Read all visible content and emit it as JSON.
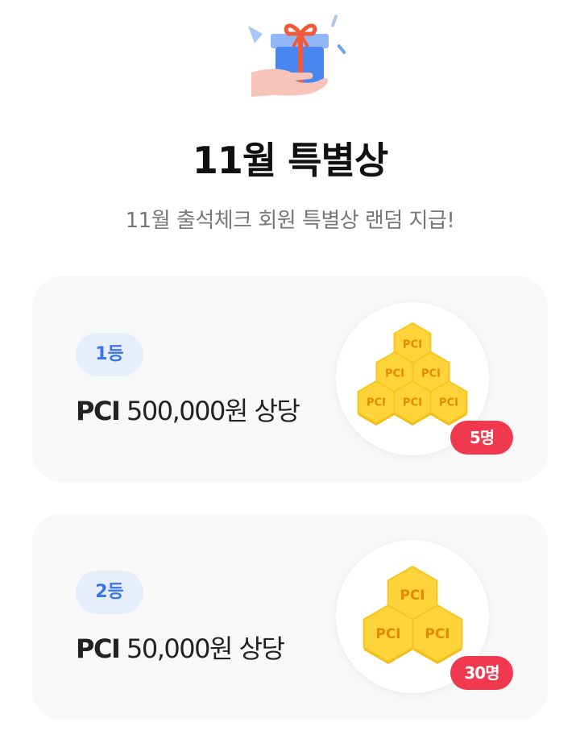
{
  "header": {
    "title": "11월 특별상",
    "subtitle": "11월 출석체크 회원 특별상 랜덤 지급!"
  },
  "icons": {
    "hero": "gift-in-hand-icon",
    "coin": "pci-coin-icon"
  },
  "colors": {
    "rank_badge_bg": "#e6eefc",
    "rank_badge_text": "#3b74e8",
    "count_badge": "#f0384f",
    "coin_gold": "#ffd43b",
    "coin_text": "#e58a00"
  },
  "prizes": [
    {
      "rank": "1등",
      "brand": "PCI",
      "amount": "500,000원 상당",
      "count": "5명",
      "coin_label": "PCI"
    },
    {
      "rank": "2등",
      "brand": "PCI",
      "amount": "50,000원 상당",
      "count": "30명",
      "coin_label": "PCI"
    }
  ]
}
